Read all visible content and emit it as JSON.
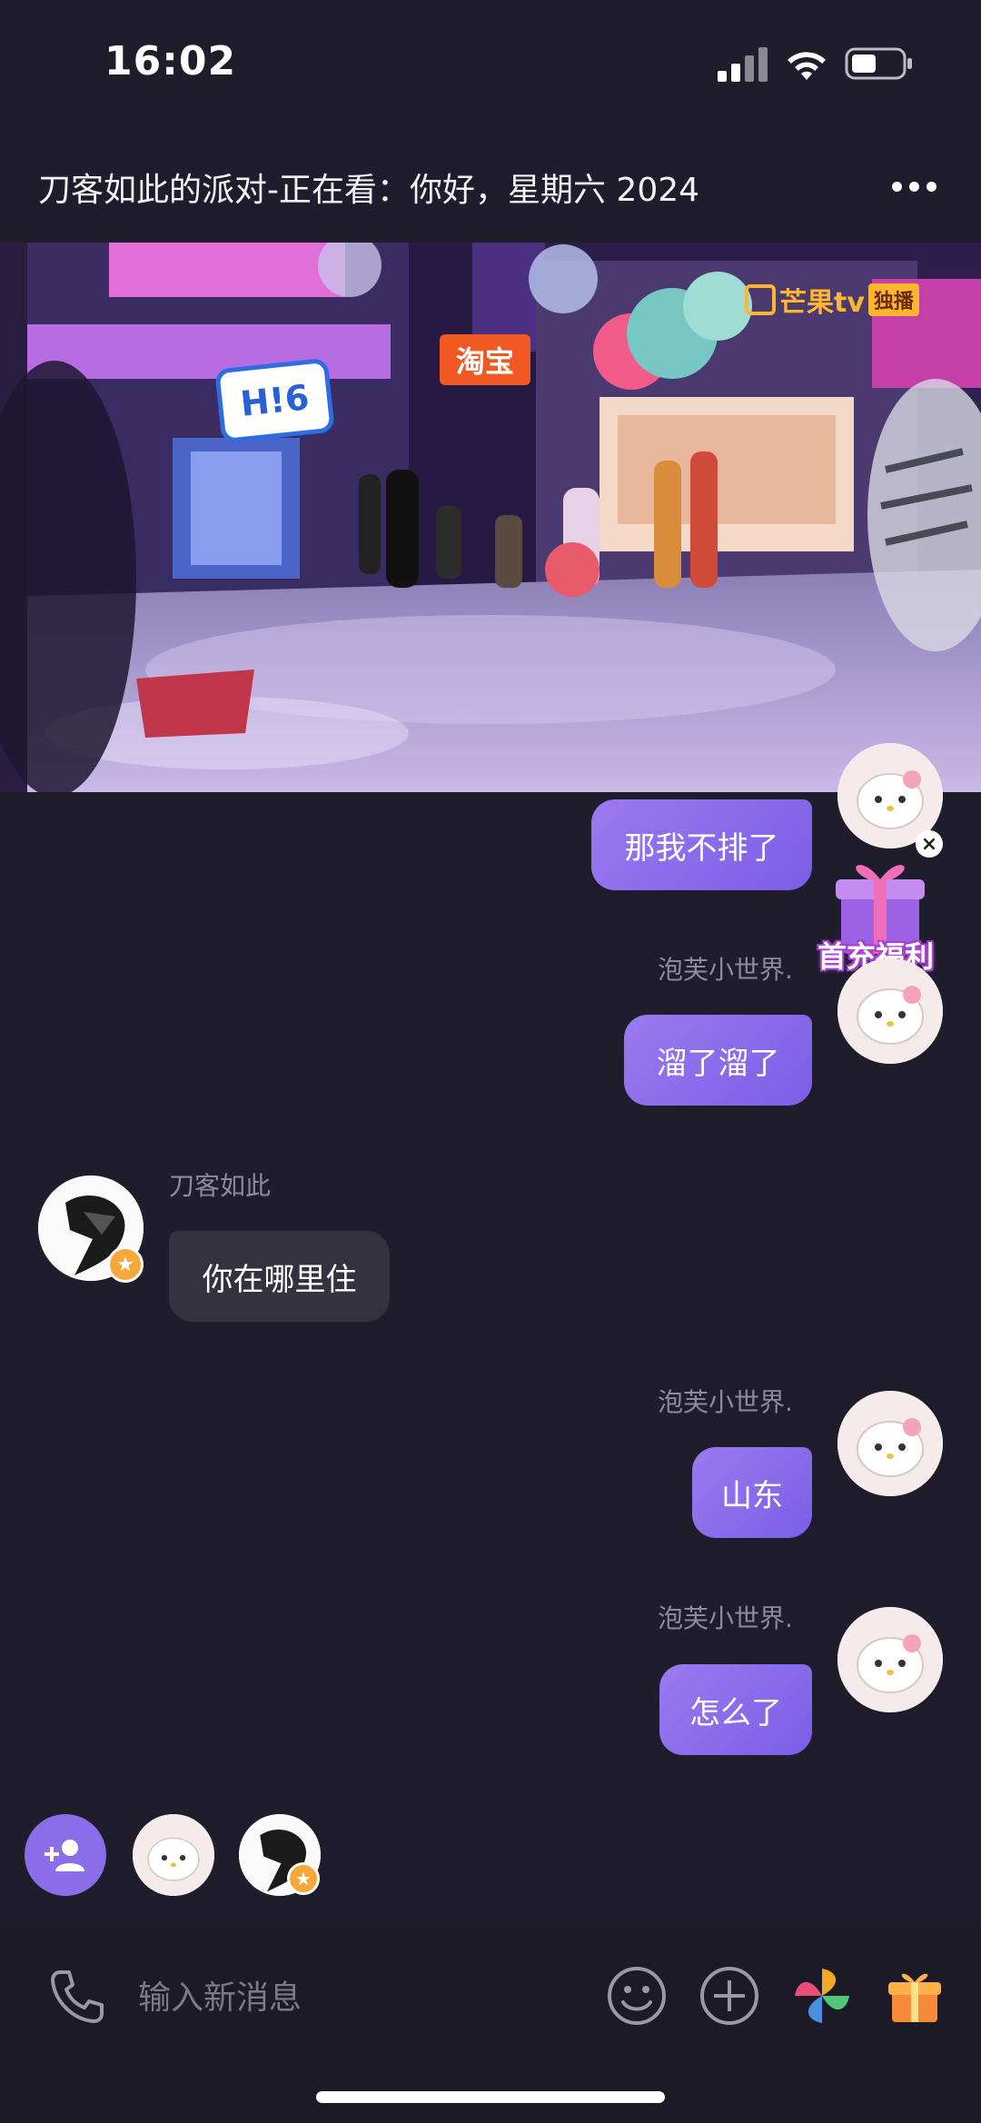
{
  "status_bar": {
    "time": "16:02"
  },
  "header": {
    "room_title": "刀客如此的派对-正在看：你好，星期六 2024"
  },
  "video": {
    "sign_h6": "H!6",
    "sign_taobao": "淘宝",
    "channel_logo": "芒果tv",
    "channel_tag": "独播"
  },
  "messages": [
    {
      "side": "out",
      "sender": "",
      "text": "那我不排了"
    },
    {
      "side": "out",
      "sender": "泡芙小世界.",
      "text": "溜了溜了"
    },
    {
      "side": "in",
      "sender": "刀客如此",
      "text": "你在哪里住"
    },
    {
      "side": "out",
      "sender": "泡芙小世界.",
      "text": "山东"
    },
    {
      "side": "out",
      "sender": "泡芙小世界.",
      "text": "怎么了"
    }
  ],
  "promo": {
    "label": "首充福利"
  },
  "composer": {
    "placeholder": "输入新消息"
  },
  "colors": {
    "accent": "#8a6de8",
    "background": "#1f1c2c",
    "bubble_in": "#35323f"
  }
}
